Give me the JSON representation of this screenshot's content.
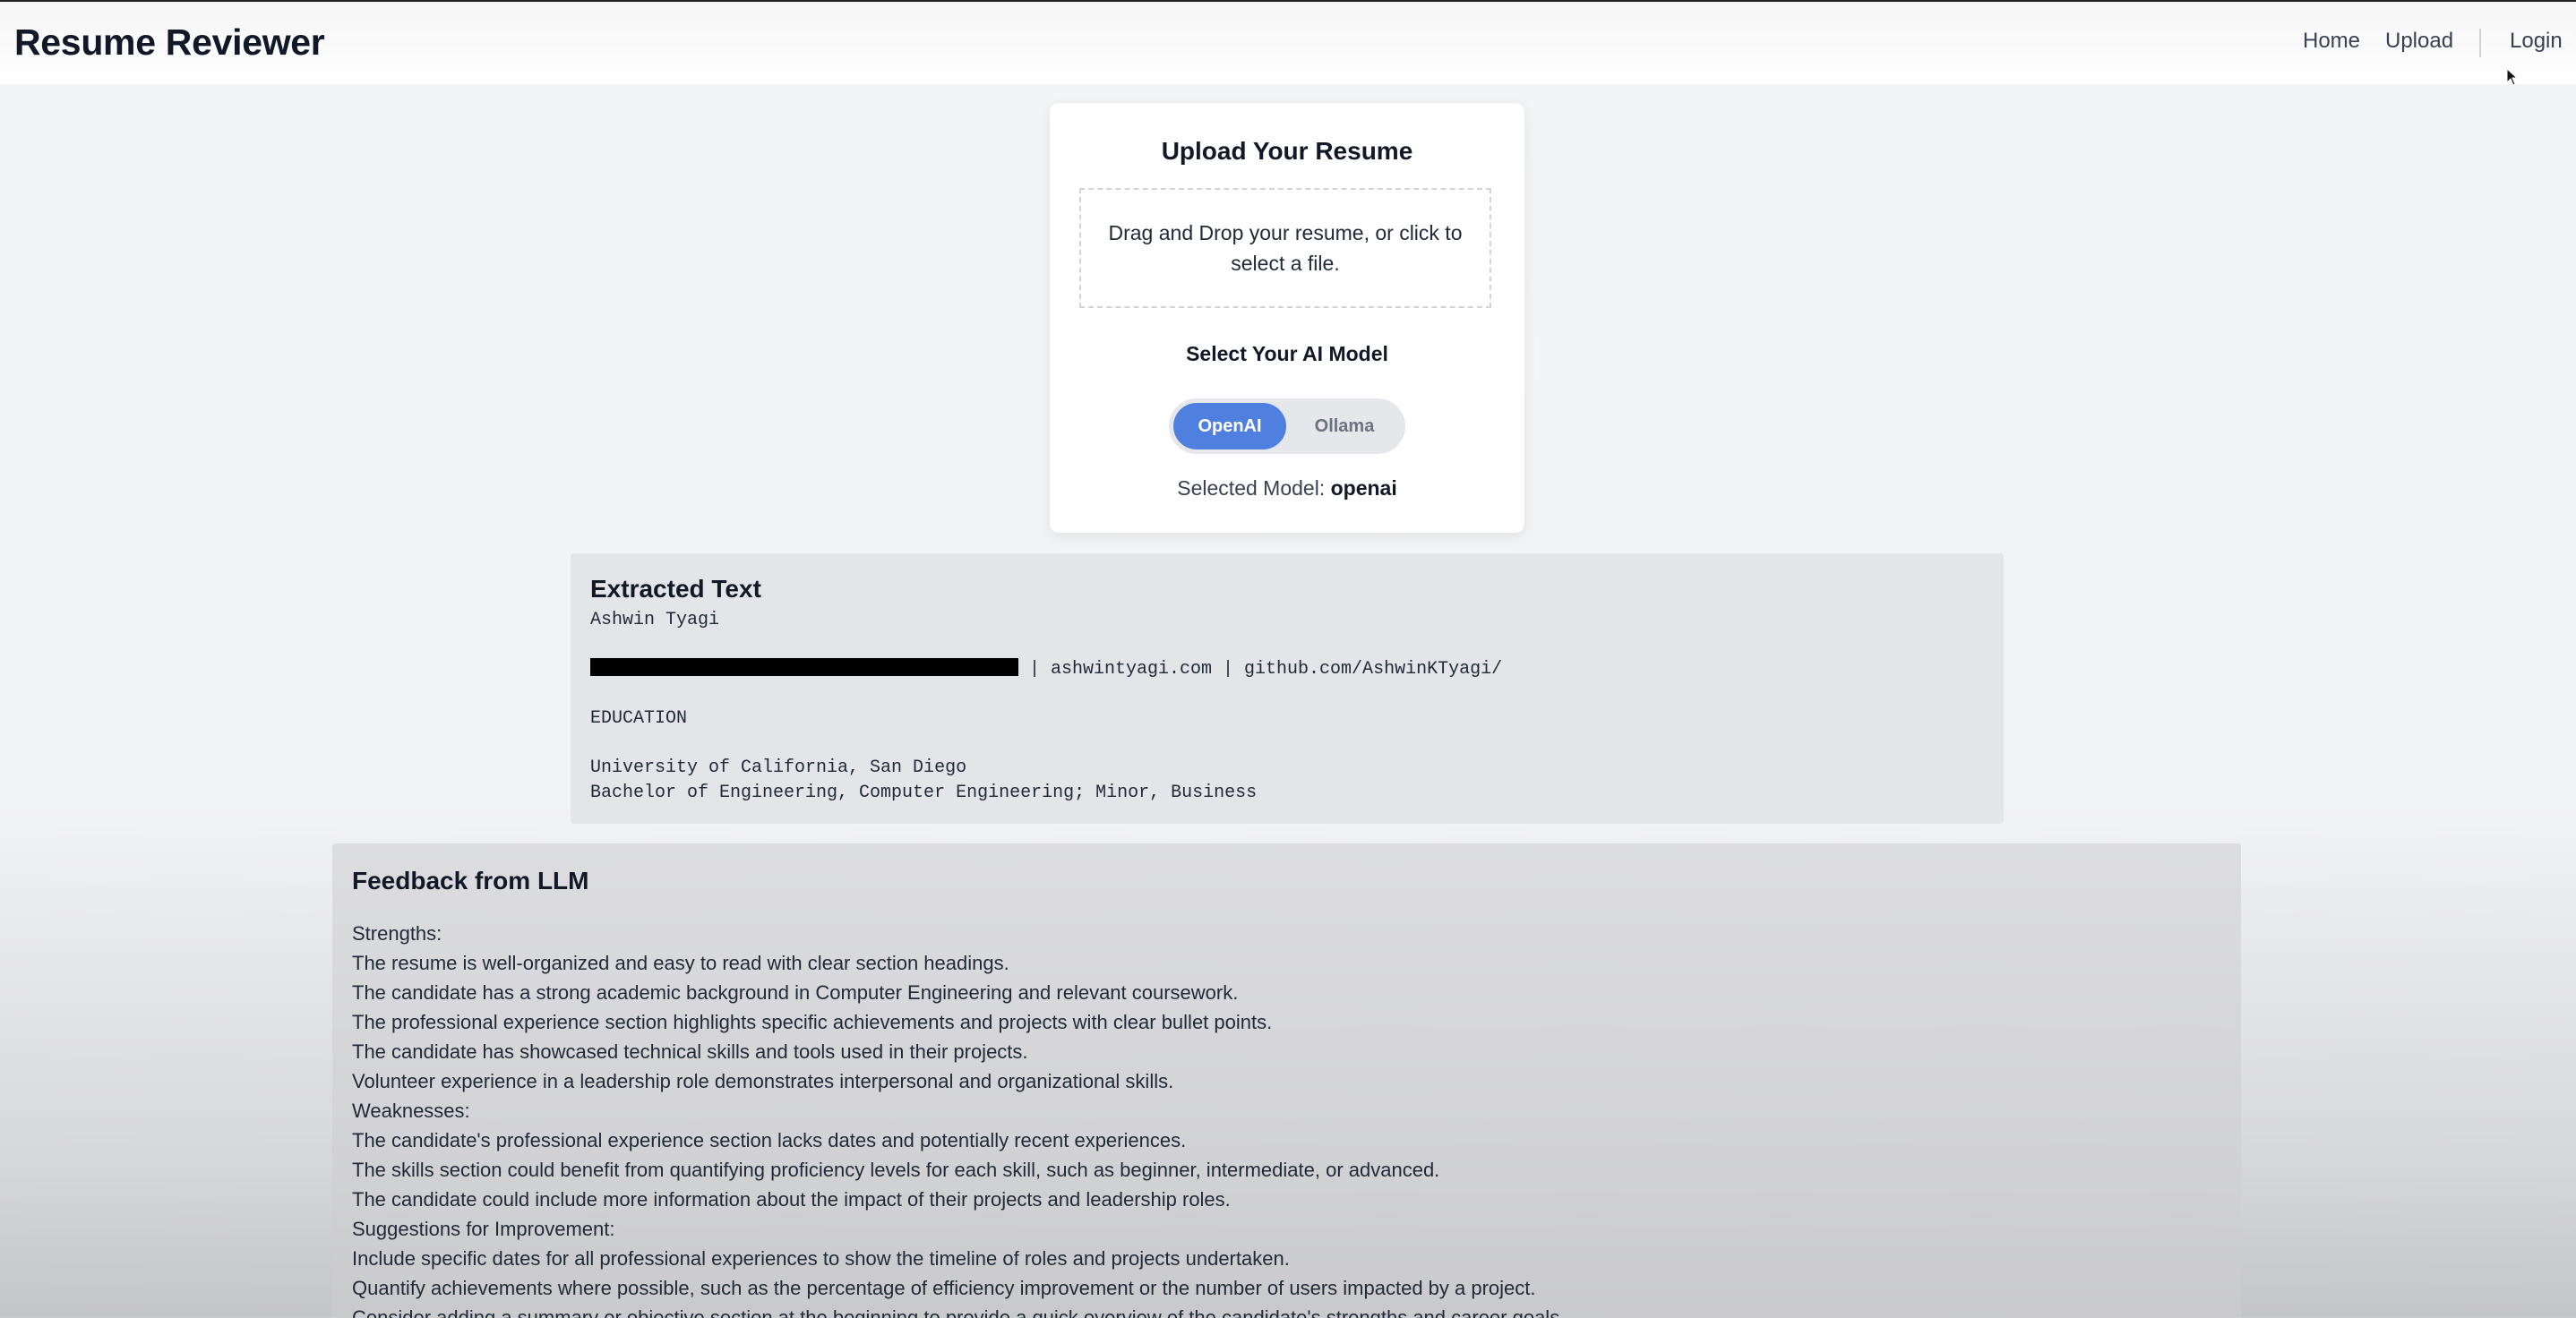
{
  "header": {
    "brand": "Resume Reviewer",
    "nav": {
      "home": "Home",
      "upload": "Upload",
      "login": "Login"
    }
  },
  "upload_card": {
    "title": "Upload Your Resume",
    "dropzone_text": "Drag and Drop your resume, or click to select a file.",
    "model_title": "Select Your AI Model",
    "options": [
      "OpenAI",
      "Ollama"
    ],
    "active_option": "OpenAI",
    "selected_label": "Selected Model:",
    "selected_value": "openai"
  },
  "extracted": {
    "title": "Extracted Text",
    "name": "Ashwin Tyagi",
    "contact_suffix": "| ashwintyagi.com | github.com/AshwinKTyagi/",
    "section": "EDUCATION",
    "school": "University of California, San Diego",
    "degree": "Bachelor of Engineering, Computer Engineering; Minor, Business"
  },
  "feedback": {
    "title": "Feedback from LLM",
    "lines": [
      "Strengths:",
      "The resume is well-organized and easy to read with clear section headings.",
      "The candidate has a strong academic background in Computer Engineering and relevant coursework.",
      "The professional experience section highlights specific achievements and projects with clear bullet points.",
      "The candidate has showcased technical skills and tools used in their projects.",
      "Volunteer experience in a leadership role demonstrates interpersonal and organizational skills.",
      "Weaknesses:",
      "The candidate's professional experience section lacks dates and potentially recent experiences.",
      "The skills section could benefit from quantifying proficiency levels for each skill, such as beginner, intermediate, or advanced.",
      "The candidate could include more information about the impact of their projects and leadership roles.",
      "Suggestions for Improvement:",
      "Include specific dates for all professional experiences to show the timeline of roles and projects undertaken.",
      "Quantify achievements where possible, such as the percentage of efficiency improvement or the number of users impacted by a project.",
      "Consider adding a summary or objective section at the beginning to provide a quick overview of the candidate's strengths and career goals."
    ]
  },
  "colors": {
    "accent": "#4f7fdf",
    "background": "#f3f4f6",
    "card": "#ffffff"
  }
}
